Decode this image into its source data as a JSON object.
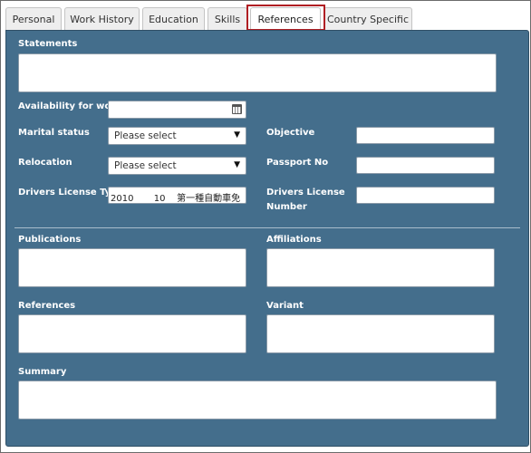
{
  "tabs": [
    {
      "label": "Personal"
    },
    {
      "label": "Work History"
    },
    {
      "label": "Education"
    },
    {
      "label": "Skills"
    },
    {
      "label": "References"
    },
    {
      "label": "Country Specific"
    }
  ],
  "active_tab": "References",
  "form": {
    "statements_label": "Statements",
    "availability_label": "Availability for work",
    "marital_status_label": "Marital status",
    "marital_status_value": "Please select",
    "relocation_label": "Relocation",
    "relocation_value": "Please select",
    "drivers_license_type_label": "Drivers License Type",
    "drivers_license_type_value": "2010       10    第一種自動車免",
    "objective_label": "Objective",
    "passport_label": "Passport No",
    "drivers_license_number_label_line1": "Drivers License",
    "drivers_license_number_label_line2": "Number",
    "publications_label": "Publications",
    "affiliations_label": "Affiliations",
    "references_label": "References",
    "variant_label": "Variant",
    "summary_label": "Summary"
  },
  "icons": {
    "calendar": "calendar-icon",
    "dropdown": "chevron-down-icon"
  },
  "colors": {
    "panel_background": "#446e8c",
    "active_tab_highlight": "#b01e23"
  }
}
